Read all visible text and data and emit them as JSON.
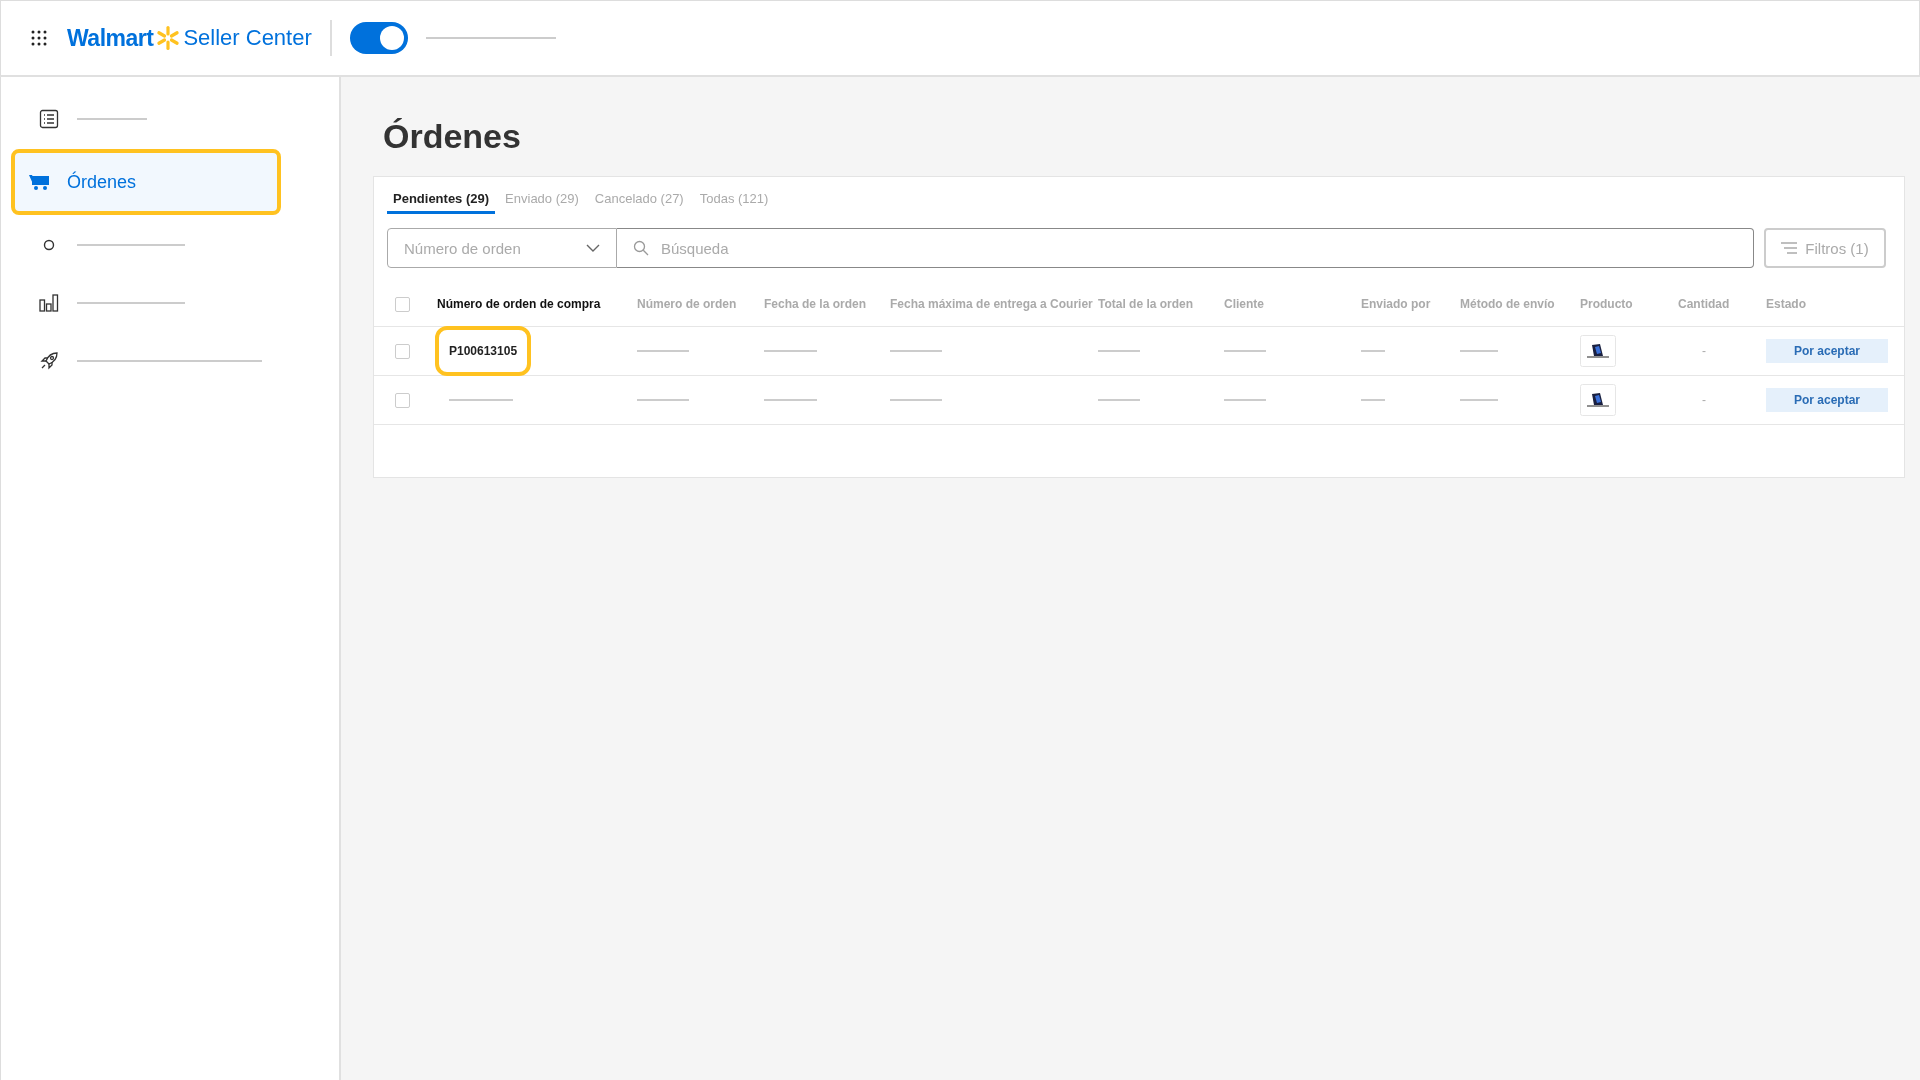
{
  "header": {
    "brand": "Walmart",
    "product": "Seller Center",
    "toggle": {
      "on": true
    }
  },
  "sidebar": {
    "items": [
      {
        "kind": "list",
        "selected": false,
        "highlighted": false
      },
      {
        "kind": "cart",
        "label": "Órdenes",
        "selected": true,
        "highlighted": true
      },
      {
        "kind": "circle",
        "selected": false,
        "highlighted": false
      },
      {
        "kind": "chart",
        "selected": false,
        "highlighted": false
      },
      {
        "kind": "rocket",
        "selected": false,
        "highlighted": false
      }
    ]
  },
  "page_title": "Órdenes",
  "tabs": [
    {
      "label": "Pendientes (29)",
      "selected": true
    },
    {
      "label": "Enviado (29)",
      "selected": false
    },
    {
      "label": "Cancelado (27)",
      "selected": false
    },
    {
      "label": "Todas (121)",
      "selected": false
    }
  ],
  "search": {
    "field_dropdown": "Número de orden",
    "placeholder": "Búsqueda",
    "filter_button": "Filtros (1)"
  },
  "table": {
    "select_all_checked": false,
    "columns": [
      "Número de orden de compra",
      "Número de orden",
      "Fecha de la orden",
      "Fecha máxima de entrega a Courier",
      "Total de la orden",
      "Cliente",
      "Enviado por",
      "Método de envío",
      "Producto",
      "Cantidad",
      "Estado"
    ],
    "rows": [
      {
        "checked": false,
        "purchase_order": "P100613105",
        "highlighted": true,
        "quantity": "-",
        "status": "Por aceptar"
      },
      {
        "checked": false,
        "quantity": "-",
        "status": "Por aceptar"
      }
    ]
  }
}
